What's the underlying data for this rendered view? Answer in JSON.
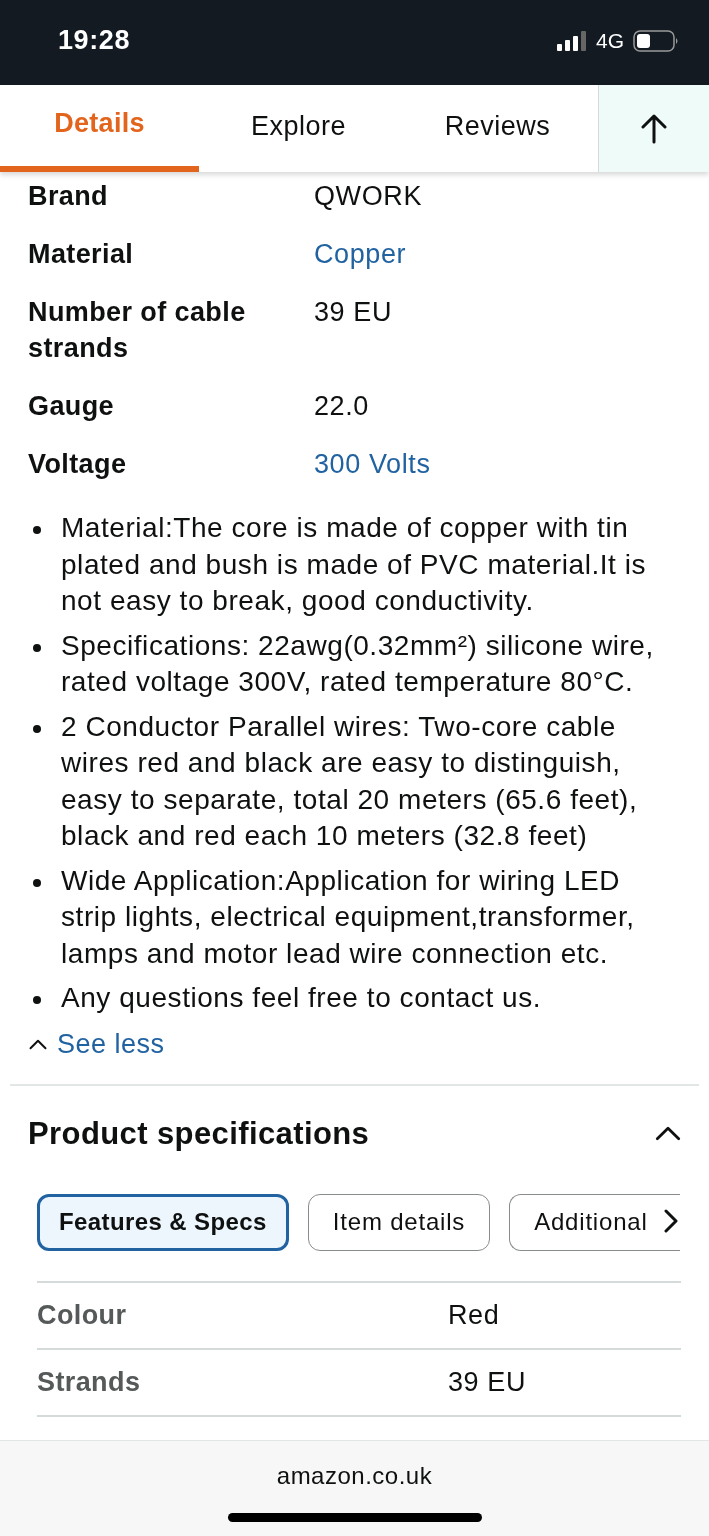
{
  "status_bar": {
    "time": "19:28",
    "network": "4G"
  },
  "tabs": [
    {
      "label": "Details",
      "selected": true
    },
    {
      "label": "Explore",
      "selected": false
    },
    {
      "label": "Reviews",
      "selected": false
    }
  ],
  "details": [
    {
      "label": "Brand",
      "value": "QWORK",
      "link": false
    },
    {
      "label": "Material",
      "value": "Copper",
      "link": true
    },
    {
      "label": "Number of cable strands",
      "value": "39 EU",
      "link": false
    },
    {
      "label": "Gauge",
      "value": "22.0",
      "link": false
    },
    {
      "label": "Voltage",
      "value": "300 Volts",
      "link": true
    }
  ],
  "bullets": [
    "Material:The core is made of copper with tin plated and bush is made of PVC material.It is not easy to break, good conductivity.",
    "Specifications: 22awg(0.32mm²) silicone wire, rated voltage 300V, rated temperature 80°C.",
    "2 Conductor Parallel wires: Two-core cable wires red and black are easy to distinguish, easy to separate, total 20 meters (65.6 feet), black and red each 10 meters (32.8 feet)",
    "Wide Application:Application for wiring LED strip lights, electrical equipment,transformer, lamps and motor lead wire connection etc.",
    "Any questions feel free to contact us."
  ],
  "see_less": "See less",
  "product_specifications": {
    "title": "Product specifications",
    "expanded": true,
    "chips": [
      {
        "label": "Features & Specs",
        "selected": true
      },
      {
        "label": "Item details",
        "selected": false
      },
      {
        "label": "Additional",
        "selected": false
      }
    ],
    "rows": [
      {
        "label": "Colour",
        "value": "Red"
      },
      {
        "label": "Strands",
        "value": "39 EU"
      }
    ]
  },
  "browser_bar": {
    "url": "amazon.co.uk"
  }
}
